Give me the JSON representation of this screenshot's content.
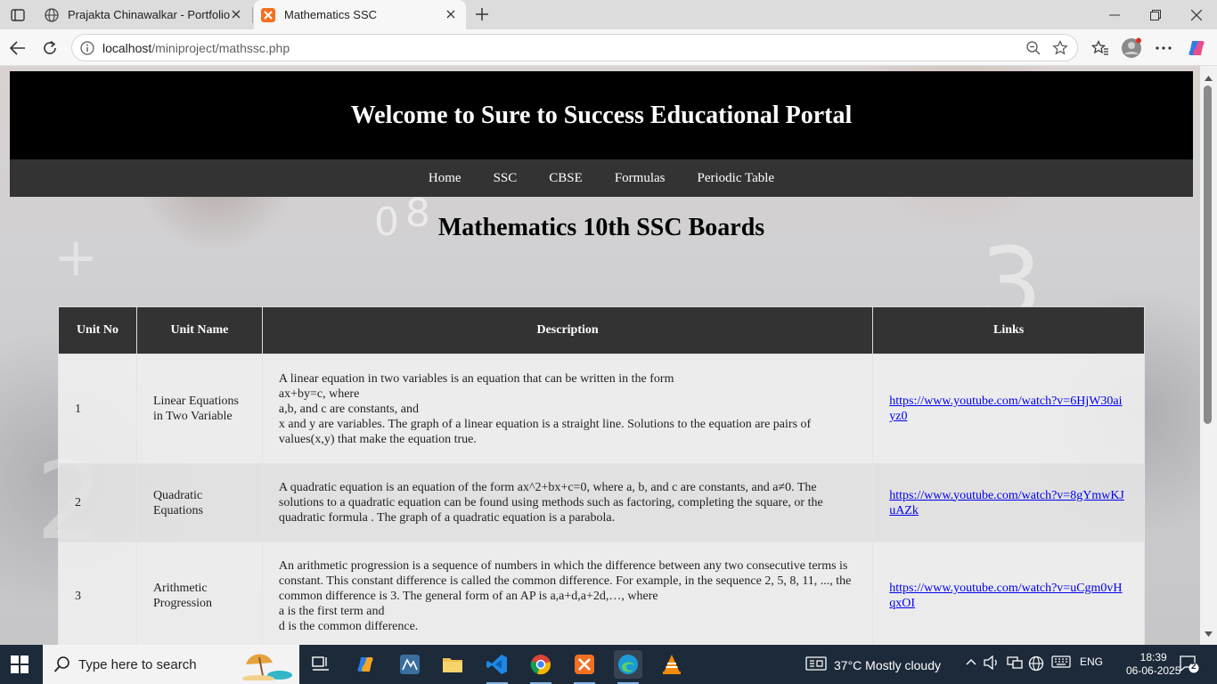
{
  "browser": {
    "tabs": [
      {
        "title": "Prajakta Chinawalkar - Portfolio",
        "active": false
      },
      {
        "title": "Mathematics SSC",
        "active": true
      }
    ],
    "url_host": "localhost",
    "url_path": "/miniproject/mathssc.php"
  },
  "site": {
    "header_title": "Welcome to Sure to Success Educational Portal",
    "nav": [
      "Home",
      "SSC",
      "CBSE",
      "Formulas",
      "Periodic Table"
    ],
    "page_title": "Mathematics 10th SSC Boards"
  },
  "table": {
    "headers": [
      "Unit No",
      "Unit Name",
      "Description",
      "Links"
    ],
    "rows": [
      {
        "unit_no": "1",
        "unit_name": "Linear Equations in Two Variable",
        "description_lines": [
          "A linear equation in two variables is an equation that can be written in the form",
          "ax+by=c, where",
          "a,b, and c are constants, and",
          "x and y are variables. The graph of a linear equation is a straight line. Solutions to the equation are pairs of values(x,y) that make the equation true."
        ],
        "link": "https://www.youtube.com/watch?v=6HjW30aiyz0"
      },
      {
        "unit_no": "2",
        "unit_name": "Quadratic Equations",
        "description_lines": [
          "A quadratic equation is an equation of the form ax^2+bx+c=0, where a, b, and c are constants, and a≠0. The solutions to a quadratic equation can be found using methods such as factoring, completing the square, or the quadratic formula . The graph of a quadratic equation is a parabola."
        ],
        "link": "https://www.youtube.com/watch?v=8gYmwKJuAZk"
      },
      {
        "unit_no": "3",
        "unit_name": "Arithmetic Progression",
        "description_lines": [
          "An arithmetic progression is a sequence of numbers in which the difference between any two consecutive terms is constant. This constant difference is called the common difference. For example, in the sequence 2, 5, 8, 11, ..., the common difference is 3. The general form of an AP is a,a+d,a+2d,…, where",
          "a is the first term and",
          "d is the common difference."
        ],
        "link": "https://www.youtube.com/watch?v=uCgm0vHqxOI"
      }
    ]
  },
  "taskbar": {
    "search_placeholder": "Type here to search",
    "weather": "37°C  Mostly cloudy",
    "language": "ENG",
    "time": "18:39",
    "date": "06-06-2025",
    "notifications": "2"
  }
}
